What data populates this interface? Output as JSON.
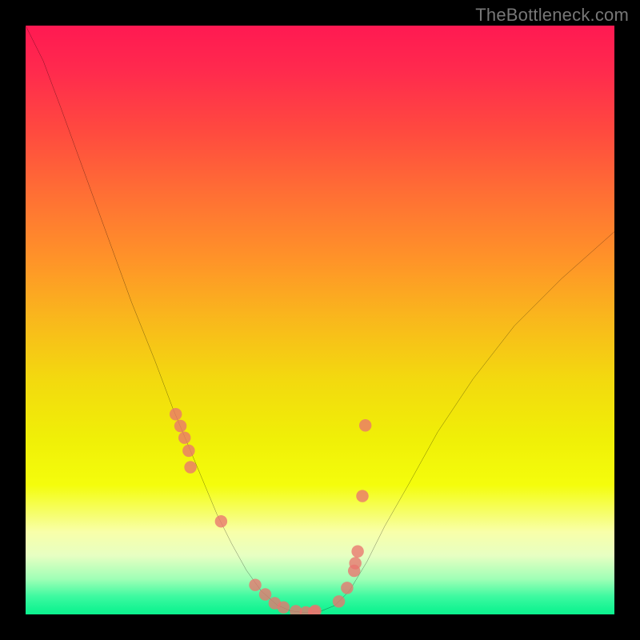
{
  "watermark": "TheBottleneck.com",
  "chart_data": {
    "type": "line",
    "title": "",
    "xlabel": "",
    "ylabel": "",
    "xlim": [
      0,
      100
    ],
    "ylim": [
      0,
      100
    ],
    "grid": false,
    "series": [
      {
        "name": "bottleneck-curve",
        "x": [
          0,
          3,
          6,
          10,
          14,
          18,
          22,
          25,
          27.5,
          30,
          32.5,
          35,
          37.5,
          40,
          42.7,
          45,
          47.5,
          50,
          52.5,
          55,
          58,
          61,
          65,
          70,
          76,
          83,
          91,
          100
        ],
        "y": [
          100,
          94,
          86,
          75,
          64,
          53,
          43,
          35,
          29,
          23,
          17,
          12,
          7.5,
          4,
          1.6,
          0.6,
          0.3,
          0.5,
          1.5,
          4,
          9,
          15,
          22,
          31,
          40,
          49,
          57,
          65
        ]
      },
      {
        "name": "scatter-dots",
        "x": [
          25.5,
          26.3,
          27.0,
          27.7,
          28.0,
          33.2,
          39.0,
          40.7,
          42.3,
          43.8,
          45.9,
          47.6,
          49.0,
          49.2,
          53.2,
          54.6,
          55.8,
          56.0,
          56.4,
          57.2,
          57.7
        ],
        "y": [
          34.0,
          32.0,
          30.0,
          27.8,
          25.0,
          15.8,
          5.0,
          3.4,
          1.9,
          1.2,
          0.55,
          0.35,
          0.4,
          0.6,
          2.2,
          4.5,
          7.4,
          8.7,
          10.7,
          20.1,
          32.1
        ]
      }
    ]
  }
}
